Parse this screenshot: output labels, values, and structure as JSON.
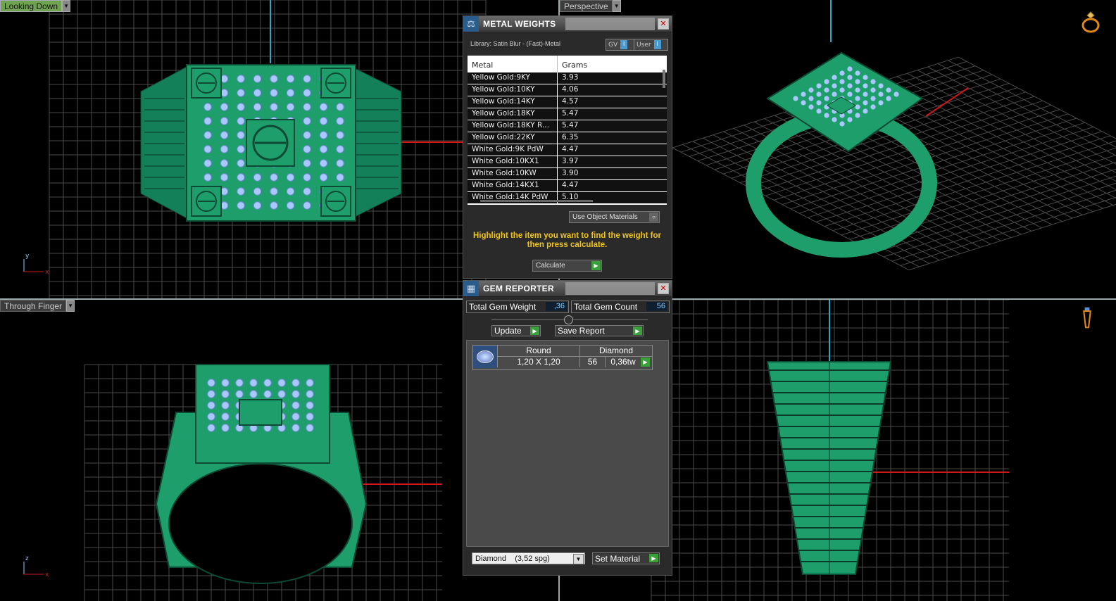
{
  "viewports": {
    "top_left": {
      "label": "Looking Down"
    },
    "top_right": {
      "label": "Perspective"
    },
    "bottom_left": {
      "label": "Through Finger"
    }
  },
  "metal_weights": {
    "title": "METAL WEIGHTS",
    "library": "Library: Satin Blur - (Fast)-Metal",
    "gv_label": "GV",
    "user_label": "User",
    "columns": [
      "Metal",
      "Grams"
    ],
    "rows": [
      [
        "Yellow Gold:9KY",
        "3.93"
      ],
      [
        "Yellow Gold:10KY",
        "4.06"
      ],
      [
        "Yellow Gold:14KY",
        "4.57"
      ],
      [
        "Yellow Gold:18KY",
        "5.47"
      ],
      [
        "Yellow Gold:18KY R...",
        "5.47"
      ],
      [
        "Yellow Gold:22KY",
        "6.35"
      ],
      [
        "White Gold:9K PdW",
        "4.47"
      ],
      [
        "White Gold:10KX1",
        "3.97"
      ],
      [
        "White Gold:10KW",
        "3.90"
      ],
      [
        "White Gold:14KX1",
        "4.47"
      ],
      [
        "White Gold:14K PdW",
        "5.10"
      ]
    ],
    "use_object_materials": "Use Object Materials",
    "hint": "Highlight the item you want to find the weight for then press calculate.",
    "calculate_label": "Calculate"
  },
  "gem_reporter": {
    "title": "GEM REPORTER",
    "total_weight_label": "Total Gem Weight",
    "total_weight_value": ",36",
    "total_count_label": "Total Gem Count",
    "total_count_value": "56",
    "update_label": "Update",
    "save_report_label": "Save Report",
    "gems": [
      {
        "shape": "Round",
        "material": "Diamond",
        "size": "1,20 X 1,20",
        "count": "56",
        "weight": "0,36tw"
      }
    ],
    "material_select": "Diamond    (3,52 spg)",
    "set_material_label": "Set Material"
  },
  "colors": {
    "ring_green": "#1e9e6a",
    "gem_blue": "#a9c8ff",
    "grid": "#4a4a4a",
    "axis_red": "#d01818",
    "axis_cyan": "#2aa7c7",
    "hint_yellow": "#f0c419"
  }
}
